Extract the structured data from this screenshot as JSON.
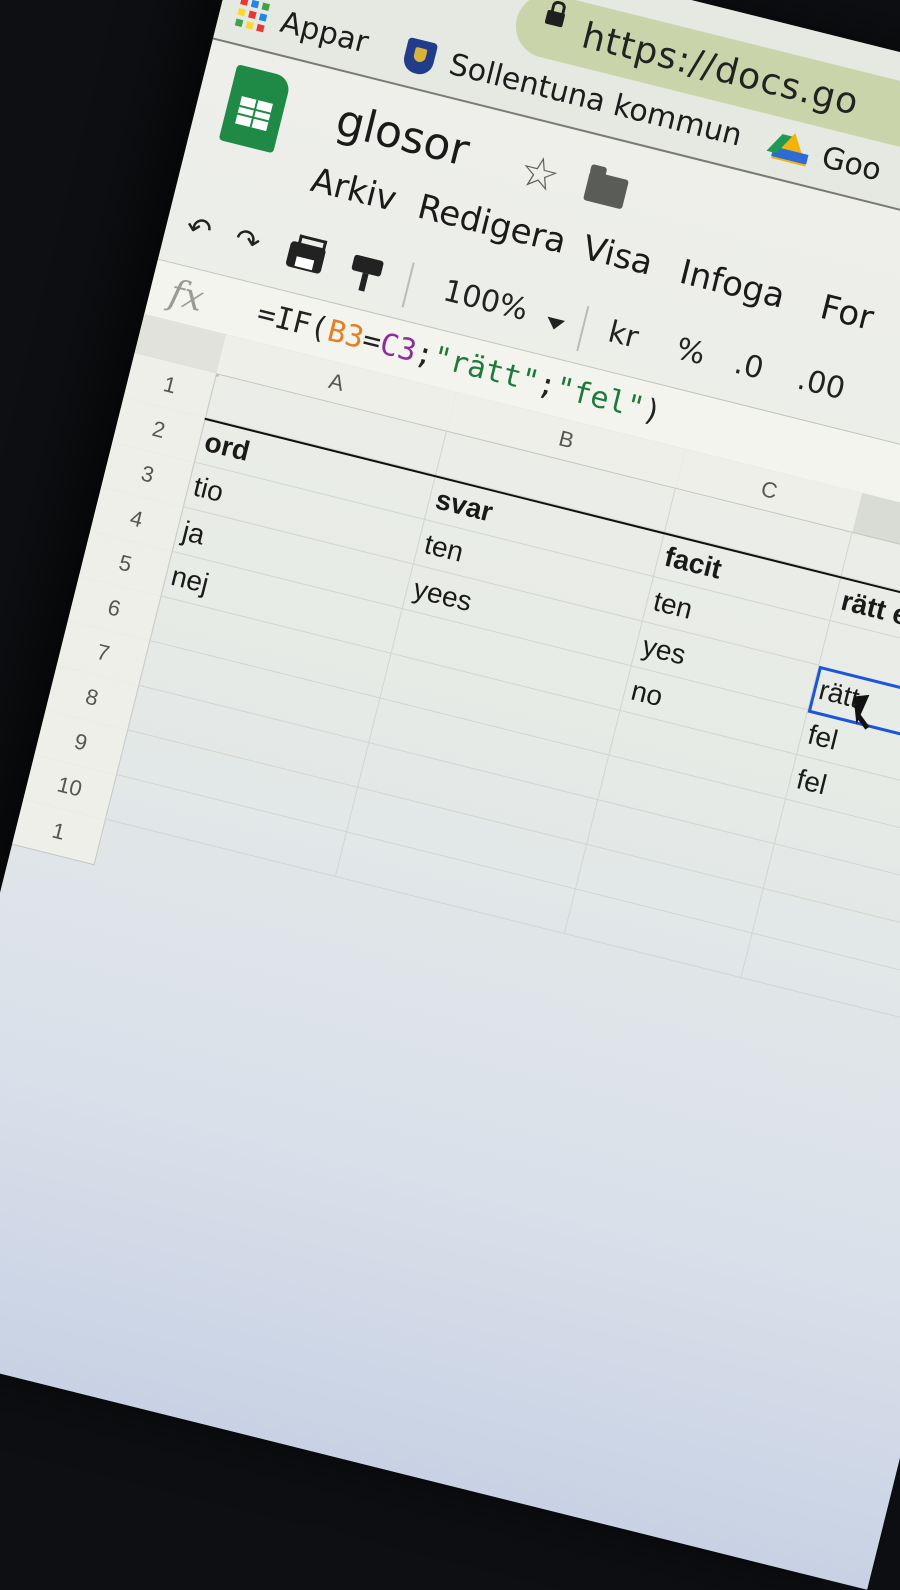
{
  "browser": {
    "back": "←",
    "forward": "→",
    "reload": "↻",
    "home": "⌂",
    "url": "https://docs.go",
    "bookmarks": [
      {
        "label": "Appar",
        "icon": "apps-grid-icon"
      },
      {
        "label": "Sollentuna kommun",
        "icon": "municipal-shield-icon"
      },
      {
        "label": "Goo",
        "icon": "google-drive-icon"
      }
    ]
  },
  "doc": {
    "title": "glosor",
    "star": "☆",
    "menu": [
      "Arkiv",
      "Redigera",
      "Visa",
      "Infoga",
      "For"
    ]
  },
  "toolbar": {
    "undo": "↶",
    "redo": "↷",
    "zoom": "100%",
    "currency": "kr",
    "percent": "%",
    "dec_decrease": ".0",
    "dec_increase": ".00"
  },
  "formula_bar": {
    "fx": "fx",
    "formula_parts": [
      "=IF(",
      "B3",
      "=",
      "C3",
      ";",
      "\"rätt\"",
      ";",
      "\"fel\"",
      ")"
    ]
  },
  "sheet": {
    "columns": [
      "A",
      "B",
      "C",
      ""
    ],
    "rows": [
      "1",
      "2",
      "3",
      "4",
      "5",
      "6",
      "7",
      "8",
      "9",
      "10",
      "1"
    ],
    "headers": [
      "ord",
      "svar",
      "facit",
      "rätt eller fel"
    ],
    "data": [
      [
        "tio",
        "ten",
        "ten",
        "rätt"
      ],
      [
        "ja",
        "yees",
        "yes",
        "fel"
      ],
      [
        "nej",
        "",
        "no",
        "fel"
      ]
    ],
    "selected": "D3"
  },
  "colors": {
    "accent": "#1a56d6",
    "ref_b3": "#e67e22",
    "ref_c3": "#8e2c9a",
    "string": "#1d7a3b",
    "url_bar": "#c9d4ab",
    "sheets_green": "#1f8a46"
  }
}
